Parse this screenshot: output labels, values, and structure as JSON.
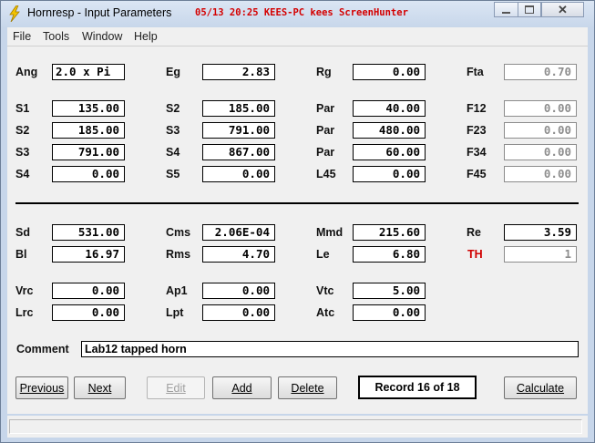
{
  "window": {
    "title": "Hornresp - Input Parameters",
    "overlay_text": "05/13 20:25 KEES-PC kees ScreenHunter"
  },
  "colors": {
    "overlay": "#d40000",
    "th_label": "#d00000"
  },
  "menu": {
    "file": "File",
    "tools": "Tools",
    "window": "Window",
    "help": "Help"
  },
  "params": {
    "ang": {
      "label": "Ang",
      "value": "2.0 x Pi"
    },
    "eg": {
      "label": "Eg",
      "value": "2.83"
    },
    "rg": {
      "label": "Rg",
      "value": "0.00"
    },
    "fta": {
      "label": "Fta",
      "value": "0.70"
    },
    "s1": {
      "label": "S1",
      "value": "135.00"
    },
    "s2": {
      "label": "S2",
      "value": "185.00"
    },
    "par1": {
      "label": "Par",
      "value": "40.00"
    },
    "f12": {
      "label": "F12",
      "value": "0.00"
    },
    "s2b": {
      "label": "S2",
      "value": "185.00"
    },
    "s3": {
      "label": "S3",
      "value": "791.00"
    },
    "par2": {
      "label": "Par",
      "value": "480.00"
    },
    "f23": {
      "label": "F23",
      "value": "0.00"
    },
    "s3b": {
      "label": "S3",
      "value": "791.00"
    },
    "s4": {
      "label": "S4",
      "value": "867.00"
    },
    "par3": {
      "label": "Par",
      "value": "60.00"
    },
    "f34": {
      "label": "F34",
      "value": "0.00"
    },
    "s4b": {
      "label": "S4",
      "value": "0.00"
    },
    "s5": {
      "label": "S5",
      "value": "0.00"
    },
    "l45": {
      "label": "L45",
      "value": "0.00"
    },
    "f45": {
      "label": "F45",
      "value": "0.00"
    },
    "sd": {
      "label": "Sd",
      "value": "531.00"
    },
    "cms": {
      "label": "Cms",
      "value": "2.06E-04"
    },
    "mmd": {
      "label": "Mmd",
      "value": "215.60"
    },
    "re": {
      "label": "Re",
      "value": "3.59"
    },
    "bl": {
      "label": "Bl",
      "value": "16.97"
    },
    "rms": {
      "label": "Rms",
      "value": "4.70"
    },
    "le": {
      "label": "Le",
      "value": "6.80"
    },
    "th": {
      "label": "TH",
      "value": "1"
    },
    "vrc": {
      "label": "Vrc",
      "value": "0.00"
    },
    "ap1": {
      "label": "Ap1",
      "value": "0.00"
    },
    "vtc": {
      "label": "Vtc",
      "value": "5.00"
    },
    "lrc": {
      "label": "Lrc",
      "value": "0.00"
    },
    "lpt": {
      "label": "Lpt",
      "value": "0.00"
    },
    "atc": {
      "label": "Atc",
      "value": "0.00"
    }
  },
  "comment": {
    "label": "Comment",
    "value": "Lab12 tapped horn"
  },
  "buttons": {
    "previous": "Previous",
    "next": "Next",
    "edit": "Edit",
    "add": "Add",
    "delete": "Delete",
    "record": "Record 16 of 18",
    "calculate": "Calculate"
  }
}
